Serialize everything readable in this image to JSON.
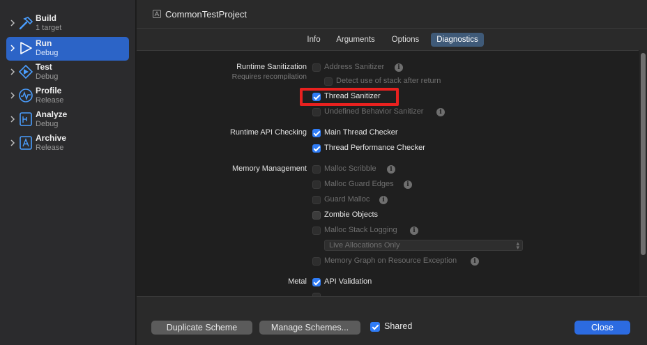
{
  "sidebar": {
    "items": [
      {
        "title": "Build",
        "subtitle": "1 target",
        "icon": "hammer-icon",
        "selected": false
      },
      {
        "title": "Run",
        "subtitle": "Debug",
        "icon": "play-icon",
        "selected": true
      },
      {
        "title": "Test",
        "subtitle": "Debug",
        "icon": "test-diamond-icon",
        "selected": false
      },
      {
        "title": "Profile",
        "subtitle": "Release",
        "icon": "waveform-icon",
        "selected": false
      },
      {
        "title": "Analyze",
        "subtitle": "Debug",
        "icon": "analyze-icon",
        "selected": false
      },
      {
        "title": "Archive",
        "subtitle": "Release",
        "icon": "archive-icon",
        "selected": false
      }
    ]
  },
  "header": {
    "project_title": "CommonTestProject",
    "tabs": [
      {
        "label": "Info",
        "active": false
      },
      {
        "label": "Arguments",
        "active": false
      },
      {
        "label": "Options",
        "active": false
      },
      {
        "label": "Diagnostics",
        "active": true
      }
    ]
  },
  "diagnostics": {
    "runtime_sanitization": {
      "label": "Runtime Sanitization",
      "sublabel": "Requires recompilation",
      "options": [
        {
          "label": "Address Sanitizer",
          "checked": false,
          "enabled": false,
          "info": true
        },
        {
          "label": "Detect use of stack after return",
          "checked": false,
          "enabled": false,
          "info": false
        },
        {
          "label": "Thread Sanitizer",
          "checked": true,
          "enabled": true,
          "info": false
        },
        {
          "label": "Undefined Behavior Sanitizer",
          "checked": false,
          "enabled": false,
          "info": true
        }
      ]
    },
    "runtime_api_checking": {
      "label": "Runtime API Checking",
      "options": [
        {
          "label": "Main Thread Checker",
          "checked": true,
          "enabled": true
        },
        {
          "label": "Thread Performance Checker",
          "checked": true,
          "enabled": true
        }
      ]
    },
    "memory_management": {
      "label": "Memory Management",
      "options": [
        {
          "label": "Malloc Scribble",
          "checked": false,
          "enabled": false,
          "info": true
        },
        {
          "label": "Malloc Guard Edges",
          "checked": false,
          "enabled": false,
          "info": true
        },
        {
          "label": "Guard Malloc",
          "checked": false,
          "enabled": false,
          "info": true
        },
        {
          "label": "Zombie Objects",
          "checked": false,
          "enabled": true,
          "info": false
        },
        {
          "label": "Malloc Stack Logging",
          "checked": false,
          "enabled": false,
          "info": true
        }
      ],
      "stack_logging_popup": "Live Allocations Only",
      "memory_graph": {
        "label": "Memory Graph on Resource Exception",
        "checked": false,
        "enabled": false,
        "info": true
      }
    },
    "metal": {
      "label": "Metal",
      "options": [
        {
          "label": "API Validation",
          "checked": true,
          "enabled": true
        }
      ]
    }
  },
  "annotation": {
    "color": "#e8211f",
    "target": "Thread Sanitizer"
  },
  "footer": {
    "duplicate_label": "Duplicate Scheme",
    "manage_label": "Manage Schemes...",
    "shared_label": "Shared",
    "shared_checked": true,
    "close_label": "Close"
  },
  "colors": {
    "accent": "#2c64c7",
    "checkbox": "#2f7cf6",
    "primary_button": "#2c6be0"
  }
}
